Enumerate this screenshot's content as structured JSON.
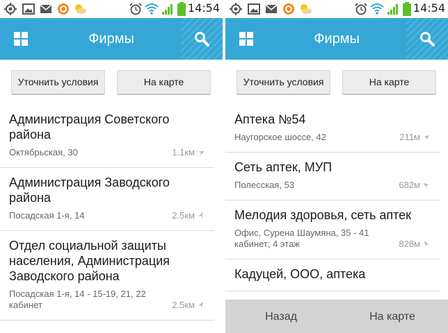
{
  "status_bar": {
    "time": "14:54",
    "icons": [
      "location-icon",
      "image-icon",
      "mail-icon",
      "app-icon",
      "weather-icon",
      "alarm-icon",
      "wifi-icon",
      "signal-icon",
      "battery-icon"
    ]
  },
  "colors": {
    "accent": "#35a7d6",
    "bottom_bar": "#d4d4d4"
  },
  "left": {
    "title": "Фирмы",
    "refine_button": "Уточнить условия",
    "map_button": "На карте",
    "items": [
      {
        "name": "Администрация Советского района",
        "address": "Октябрьская, 30",
        "distance": "1.1км"
      },
      {
        "name": "Администрация Заводского района",
        "address": "Посадская 1-я, 14",
        "distance": "2.5км"
      },
      {
        "name": "Отдел социальной защиты населения, Администрация Заводского района",
        "address": "Посадская 1-я, 14 - 15-19, 21, 22 кабинет",
        "distance": "2.5км"
      }
    ]
  },
  "right": {
    "title": "Фирмы",
    "refine_button": "Уточнить условия",
    "map_button": "На карте",
    "items": [
      {
        "name": "Аптека №54",
        "address": "Наугорское шоссе, 42",
        "distance": "211м"
      },
      {
        "name": "Сеть аптек, МУП",
        "address": "Полесская, 53",
        "distance": "682м"
      },
      {
        "name": "Мелодия здоровья, сеть аптек",
        "address": "Офис, Сурена Шаумяна, 35 - 41 кабинет; 4 этаж",
        "distance": "828м"
      },
      {
        "name": "Кадуцей, ООО, аптека",
        "address": "",
        "distance": ""
      }
    ],
    "bottom_bar": {
      "back": "Назад",
      "map": "На карте"
    }
  }
}
